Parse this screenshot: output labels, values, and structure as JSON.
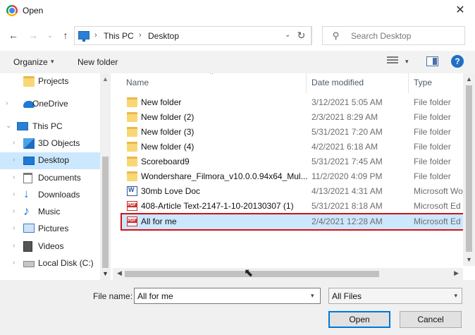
{
  "window": {
    "title": "Open",
    "close_glyph": "✕"
  },
  "nav": {
    "back_glyph": "←",
    "forward_glyph": "→",
    "recent_glyph": "⌄",
    "up_glyph": "↑",
    "address_parts": [
      "This PC",
      "Desktop"
    ],
    "address_sep": "›",
    "dropdown_glyph": "⌄",
    "refresh_glyph": "↻",
    "search_placeholder": "Search Desktop",
    "search_glyph": "⚲"
  },
  "toolbar": {
    "organize": "Organize",
    "caret": "▾",
    "new_folder": "New folder",
    "help": "?"
  },
  "sidebar": {
    "items": [
      {
        "label": "Projects",
        "icon": "folder-icon",
        "chevron": ""
      },
      {
        "label": "OneDrive",
        "icon": "cloud-icon",
        "chevron": "›"
      },
      {
        "label": "This PC",
        "icon": "pc-icon",
        "chevron": "⌄"
      },
      {
        "label": "3D Objects",
        "icon": "3d-objects-icon",
        "chevron": "›"
      },
      {
        "label": "Desktop",
        "icon": "desktop-icon",
        "chevron": "›",
        "selected": true
      },
      {
        "label": "Documents",
        "icon": "documents-icon",
        "chevron": "›"
      },
      {
        "label": "Downloads",
        "icon": "downloads-icon",
        "chevron": "›"
      },
      {
        "label": "Music",
        "icon": "music-icon",
        "chevron": "›"
      },
      {
        "label": "Pictures",
        "icon": "pictures-icon",
        "chevron": "›"
      },
      {
        "label": "Videos",
        "icon": "videos-icon",
        "chevron": "›"
      },
      {
        "label": "Local Disk (C:)",
        "icon": "disk-icon",
        "chevron": "›"
      }
    ],
    "scroll_up": "▲",
    "scroll_down": "▼"
  },
  "files": {
    "sort_glyph": "^",
    "columns": {
      "name": "Name",
      "date": "Date modified",
      "type": "Type"
    },
    "rows": [
      {
        "name": "New folder",
        "date": "3/12/2021 5:05 AM",
        "type": "File folder",
        "kind": "folder"
      },
      {
        "name": "New folder (2)",
        "date": "2/3/2021 8:29 AM",
        "type": "File folder",
        "kind": "folder"
      },
      {
        "name": "New folder (3)",
        "date": "5/31/2021 7:20 AM",
        "type": "File folder",
        "kind": "folder"
      },
      {
        "name": "New folder (4)",
        "date": "4/2/2021 6:18 AM",
        "type": "File folder",
        "kind": "folder"
      },
      {
        "name": "Scoreboard9",
        "date": "5/31/2021 7:45 AM",
        "type": "File folder",
        "kind": "folder"
      },
      {
        "name": "Wondershare_Filmora_v10.0.0.94x64_Mul...",
        "date": "11/2/2020 4:09 PM",
        "type": "File folder",
        "kind": "folder"
      },
      {
        "name": "30mb Love Doc",
        "date": "4/13/2021 4:31 AM",
        "type": "Microsoft Wo",
        "kind": "word"
      },
      {
        "name": "408-Article Text-2147-1-10-20130307 (1)",
        "date": "5/31/2021 8:18 AM",
        "type": "Microsoft Ed",
        "kind": "pdf"
      },
      {
        "name": "All for me",
        "date": "2/4/2021 12:28 AM",
        "type": "Microsoft Ed",
        "kind": "pdf",
        "selected": true
      }
    ],
    "scroll_up": "▲",
    "scroll_down": "▼",
    "scroll_left": "◀",
    "scroll_right": "▶"
  },
  "bottom": {
    "file_name_label": "File name:",
    "file_name_value": "All for me",
    "dropdown_glyph": "▾",
    "file_type": "All Files",
    "open": "Open",
    "cancel": "Cancel"
  },
  "colors": {
    "selection": "#cce8ff",
    "highlight_border": "#d0121b",
    "accent": "#0078d7",
    "folder": "#f8d775"
  }
}
